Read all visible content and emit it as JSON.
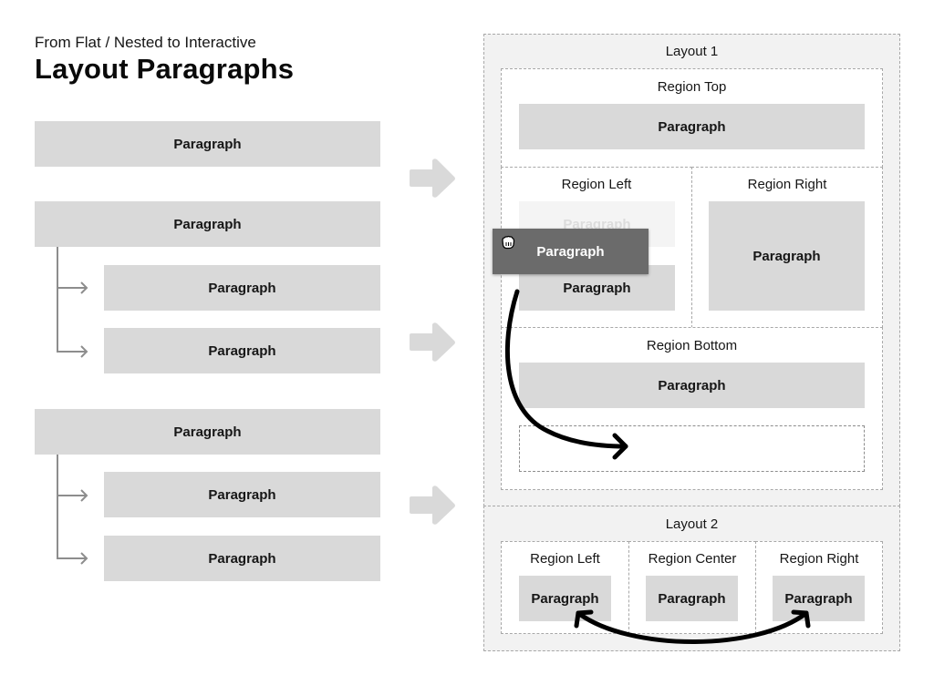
{
  "header": {
    "subtitle": "From Flat / Nested to Interactive",
    "title": "Layout Paragraphs"
  },
  "left_column": {
    "groups": [
      {
        "type": "flat",
        "paragraph": "Paragraph"
      },
      {
        "type": "nested",
        "paragraph": "Paragraph",
        "children": [
          "Paragraph",
          "Paragraph"
        ]
      },
      {
        "type": "nested",
        "paragraph": "Paragraph",
        "children": [
          "Paragraph",
          "Paragraph"
        ]
      }
    ]
  },
  "layout1": {
    "title": "Layout 1",
    "region_top": {
      "label": "Region Top",
      "paragraph": "Paragraph"
    },
    "region_left": {
      "label": "Region Left",
      "ghost_paragraph": "Paragraph",
      "paragraph": "Paragraph"
    },
    "dragging_paragraph": "Paragraph",
    "region_right": {
      "label": "Region Right",
      "paragraph": "Paragraph"
    },
    "region_bottom": {
      "label": "Region Bottom",
      "paragraph": "Paragraph"
    }
  },
  "layout2": {
    "title": "Layout 2",
    "regions": [
      {
        "label": "Region Left",
        "paragraph": "Paragraph"
      },
      {
        "label": "Region Center",
        "paragraph": "Paragraph"
      },
      {
        "label": "Region Right",
        "paragraph": "Paragraph"
      }
    ]
  },
  "colors": {
    "paragraph_fill": "#d9d9d9",
    "layout_fill": "#f2f2f2",
    "drag_fill": "#6b6b6b",
    "connector": "#8d8d8d",
    "arrow": "#000000"
  }
}
